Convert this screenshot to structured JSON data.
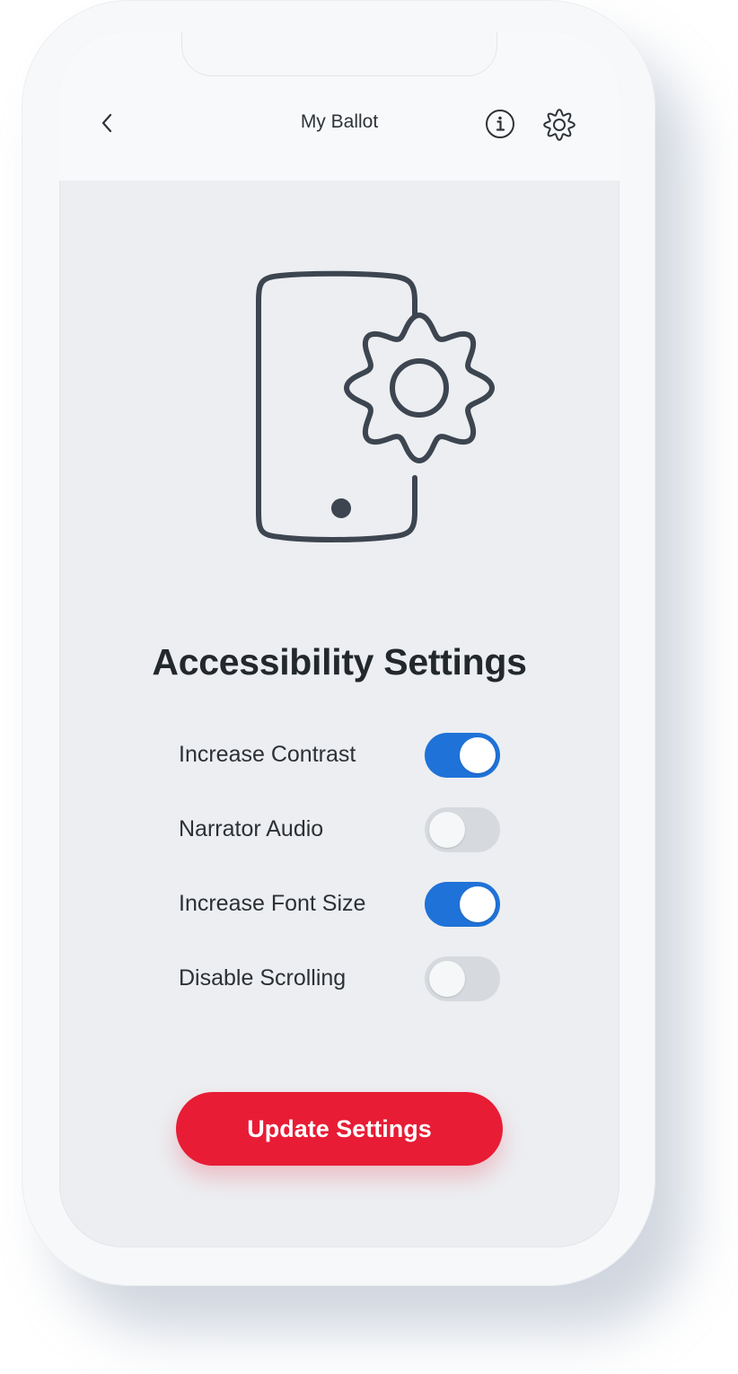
{
  "header": {
    "title": "My Ballot",
    "back_icon": "chevron-left-icon",
    "info_icon": "info-icon",
    "settings_icon": "gear-icon"
  },
  "hero": {
    "icon": "phone-settings-icon"
  },
  "main": {
    "title": "Accessibility Settings",
    "settings": [
      {
        "label": "Increase Contrast",
        "enabled": true
      },
      {
        "label": "Narrator Audio",
        "enabled": false
      },
      {
        "label": "Increase Font Size",
        "enabled": true
      },
      {
        "label": "Disable Scrolling",
        "enabled": false
      }
    ],
    "update_button": "Update Settings"
  },
  "colors": {
    "accent": "#1f72d8",
    "toggle_off": "#d6dade",
    "button": "#e81c35",
    "icon_stroke": "#3c4550"
  }
}
